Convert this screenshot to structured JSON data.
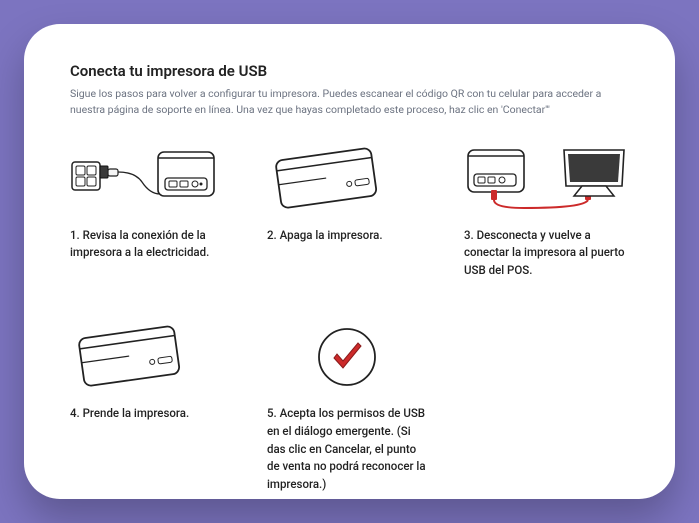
{
  "title": "Conecta tu impresora de USB",
  "subtitle": "Sigue los pasos para volver a configurar tu impresora. Puedes escanear el código QR con tu celular para acceder a nuestra página de soporte en línea. Una vez que hayas completado este proceso, haz clic en 'Conectar'\"",
  "steps": {
    "s1": "1. Revisa la conexión de la impresora a la electricidad.",
    "s2": "2. Apaga la impresora.",
    "s3": "3. Desconecta y vuelve a conectar la impresora al puerto USB del POS.",
    "s4": "4. Prende la impresora.",
    "s5": "5. Acepta los permisos de USB en el diálogo emergente. (Si das clic en Cancelar, el punto de venta no podrá reconocer la impresora.)"
  }
}
